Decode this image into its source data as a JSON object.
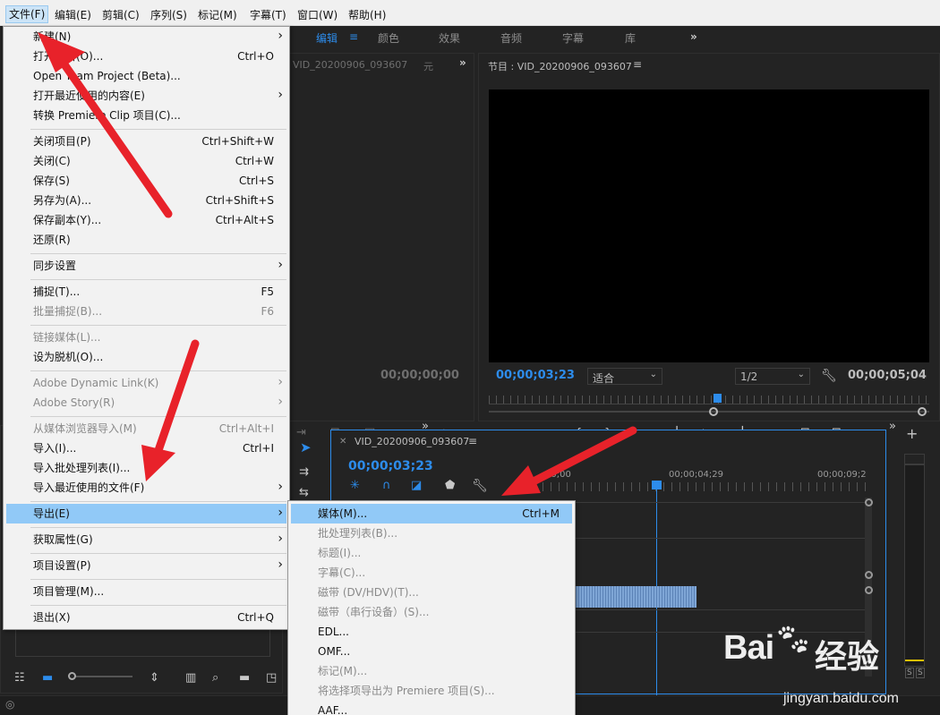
{
  "menubar": {
    "items": [
      "文件(F)",
      "编辑(E)",
      "剪辑(C)",
      "序列(S)",
      "标记(M)",
      "字幕(T)",
      "窗口(W)",
      "帮助(H)"
    ]
  },
  "workspace_tabs": [
    "编辑",
    "颜色",
    "效果",
    "音频",
    "字幕",
    "库"
  ],
  "source_panel": {
    "title": "VID_20200906_093607",
    "tail": "元",
    "timecode": "00;00;00;00"
  },
  "program_panel": {
    "title": "节目 : VID_20200906_093607",
    "timecode_left": "00;00;03;23",
    "fit": "适合",
    "resolution": "1/2",
    "timecode_right": "00;00;05;04"
  },
  "timeline": {
    "title": "VID_20200906_093607",
    "timecode": "00;00;03;23",
    "ruler": [
      "00;00",
      "00;00;04;29",
      "00;00;09;2"
    ]
  },
  "audio_meter": {
    "labels": [
      "S",
      "S"
    ]
  },
  "file_menu": {
    "items": [
      {
        "label": "新建(N)",
        "shortcut": "",
        "submenu": true,
        "disabled": false
      },
      {
        "label": "打开项目(O)...",
        "shortcut": "Ctrl+O",
        "submenu": false,
        "disabled": false
      },
      {
        "label": "Open Team Project (Beta)...",
        "shortcut": "",
        "submenu": false,
        "disabled": false
      },
      {
        "label": "打开最近使用的内容(E)",
        "shortcut": "",
        "submenu": true,
        "disabled": false
      },
      {
        "label": "转换 Premiere Clip 项目(C)...",
        "shortcut": "",
        "submenu": false,
        "disabled": false
      },
      {
        "label": "关闭项目(P)",
        "shortcut": "Ctrl+Shift+W",
        "submenu": false,
        "disabled": false
      },
      {
        "label": "关闭(C)",
        "shortcut": "Ctrl+W",
        "submenu": false,
        "disabled": false
      },
      {
        "label": "保存(S)",
        "shortcut": "Ctrl+S",
        "submenu": false,
        "disabled": false
      },
      {
        "label": "另存为(A)...",
        "shortcut": "Ctrl+Shift+S",
        "submenu": false,
        "disabled": false
      },
      {
        "label": "保存副本(Y)...",
        "shortcut": "Ctrl+Alt+S",
        "submenu": false,
        "disabled": false
      },
      {
        "label": "还原(R)",
        "shortcut": "",
        "submenu": false,
        "disabled": false
      },
      {
        "label": "同步设置",
        "shortcut": "",
        "submenu": true,
        "disabled": false
      },
      {
        "label": "捕捉(T)...",
        "shortcut": "F5",
        "submenu": false,
        "disabled": false
      },
      {
        "label": "批量捕捉(B)...",
        "shortcut": "F6",
        "submenu": false,
        "disabled": true
      },
      {
        "label": "链接媒体(L)...",
        "shortcut": "",
        "submenu": false,
        "disabled": true
      },
      {
        "label": "设为脱机(O)...",
        "shortcut": "",
        "submenu": false,
        "disabled": false
      },
      {
        "label": "Adobe Dynamic Link(K)",
        "shortcut": "",
        "submenu": true,
        "disabled": true
      },
      {
        "label": "Adobe Story(R)",
        "shortcut": "",
        "submenu": true,
        "disabled": true
      },
      {
        "label": "从媒体浏览器导入(M)",
        "shortcut": "Ctrl+Alt+I",
        "submenu": false,
        "disabled": true
      },
      {
        "label": "导入(I)...",
        "shortcut": "Ctrl+I",
        "submenu": false,
        "disabled": false
      },
      {
        "label": "导入批处理列表(I)...",
        "shortcut": "",
        "submenu": false,
        "disabled": false
      },
      {
        "label": "导入最近使用的文件(F)",
        "shortcut": "",
        "submenu": true,
        "disabled": false
      },
      {
        "label": "导出(E)",
        "shortcut": "",
        "submenu": true,
        "disabled": false
      },
      {
        "label": "获取属性(G)",
        "shortcut": "",
        "submenu": true,
        "disabled": false
      },
      {
        "label": "项目设置(P)",
        "shortcut": "",
        "submenu": true,
        "disabled": false
      },
      {
        "label": "项目管理(M)...",
        "shortcut": "",
        "submenu": false,
        "disabled": false
      },
      {
        "label": "退出(X)",
        "shortcut": "Ctrl+Q",
        "submenu": false,
        "disabled": false
      }
    ]
  },
  "export_menu": {
    "items": [
      {
        "label": "媒体(M)...",
        "shortcut": "Ctrl+M",
        "disabled": false
      },
      {
        "label": "批处理列表(B)...",
        "shortcut": "",
        "disabled": true
      },
      {
        "label": "标题(I)...",
        "shortcut": "",
        "disabled": true
      },
      {
        "label": "字幕(C)...",
        "shortcut": "",
        "disabled": true
      },
      {
        "label": "磁带 (DV/HDV)(T)...",
        "shortcut": "",
        "disabled": true
      },
      {
        "label": "磁带（串行设备）(S)...",
        "shortcut": "",
        "disabled": true
      },
      {
        "label": "EDL...",
        "shortcut": "",
        "disabled": false
      },
      {
        "label": "OMF...",
        "shortcut": "",
        "disabled": false
      },
      {
        "label": "标记(M)...",
        "shortcut": "",
        "disabled": true
      },
      {
        "label": "将选择项导出为 Premiere 项目(S)...",
        "shortcut": "",
        "disabled": true
      },
      {
        "label": "AAF...",
        "shortcut": "",
        "disabled": false
      }
    ]
  },
  "watermark": {
    "brand": "Bai",
    "brand2": "经验",
    "url": "jingyan.baidu.com"
  },
  "colors": {
    "accent": "#2d8ceb",
    "arrow": "#e8222a",
    "highlight": "#91c9f7"
  }
}
